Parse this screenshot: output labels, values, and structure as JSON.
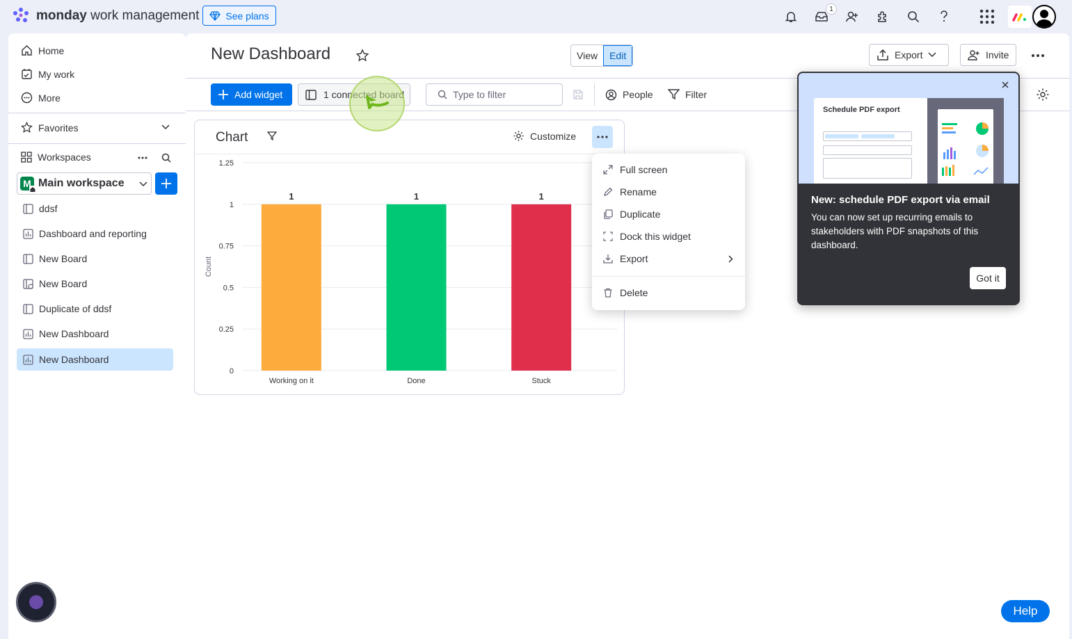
{
  "topbar": {
    "brand_bold": "monday",
    "brand_rest": "work management",
    "see_plans": "See plans",
    "inbox_badge": "1"
  },
  "sidebar": {
    "nav": [
      {
        "label": "Home",
        "icon": "home-icon"
      },
      {
        "label": "My work",
        "icon": "calendar-check-icon"
      },
      {
        "label": "More",
        "icon": "more-circle-icon"
      }
    ],
    "favorites": "Favorites",
    "workspaces": "Workspaces",
    "workspace_badge": "M",
    "workspace_name": "Main workspace",
    "boards": [
      {
        "label": "ddsf",
        "icon": "board-icon",
        "active": false
      },
      {
        "label": "Dashboard and reporting",
        "icon": "dashboard-icon",
        "active": false
      },
      {
        "label": "New Board",
        "icon": "board-icon",
        "active": false
      },
      {
        "label": "New Board",
        "icon": "board-shared-icon",
        "active": false
      },
      {
        "label": "Duplicate of ddsf",
        "icon": "board-icon",
        "active": false
      },
      {
        "label": "New Dashboard",
        "icon": "dashboard-icon",
        "active": false
      },
      {
        "label": "New Dashboard",
        "icon": "dashboard-icon",
        "active": true
      }
    ]
  },
  "header": {
    "title": "New Dashboard",
    "view": "View",
    "edit": "Edit",
    "export": "Export",
    "invite": "Invite"
  },
  "toolbar": {
    "add_widget": "Add widget",
    "connected_board": "1 connected board",
    "filter_placeholder": "Type to filter",
    "people": "People",
    "filter": "Filter"
  },
  "widget": {
    "title": "Chart",
    "customize": "Customize"
  },
  "chart_data": {
    "type": "bar",
    "categories": [
      "Working on it",
      "Done",
      "Stuck"
    ],
    "values": [
      1,
      1,
      1
    ],
    "colors": [
      "#fdab3d",
      "#00c875",
      "#df2f4a"
    ],
    "data_labels": [
      "1",
      "1",
      "1"
    ],
    "ylabel": "Count",
    "ylim": [
      0,
      1.25
    ],
    "yticks": [
      "0",
      "0.25",
      "0.5",
      "0.75",
      "1",
      "1.25"
    ],
    "grid": true
  },
  "menu": {
    "items": [
      "Full screen",
      "Rename",
      "Duplicate",
      "Dock this widget",
      "Export"
    ],
    "delete": "Delete"
  },
  "tooltip": {
    "image_title": "Schedule PDF export",
    "title": "New: schedule PDF export via email",
    "body": "You can now set up recurring emails to stakeholders with PDF snapshots of this dashboard.",
    "button": "Got it"
  },
  "help": "Help"
}
